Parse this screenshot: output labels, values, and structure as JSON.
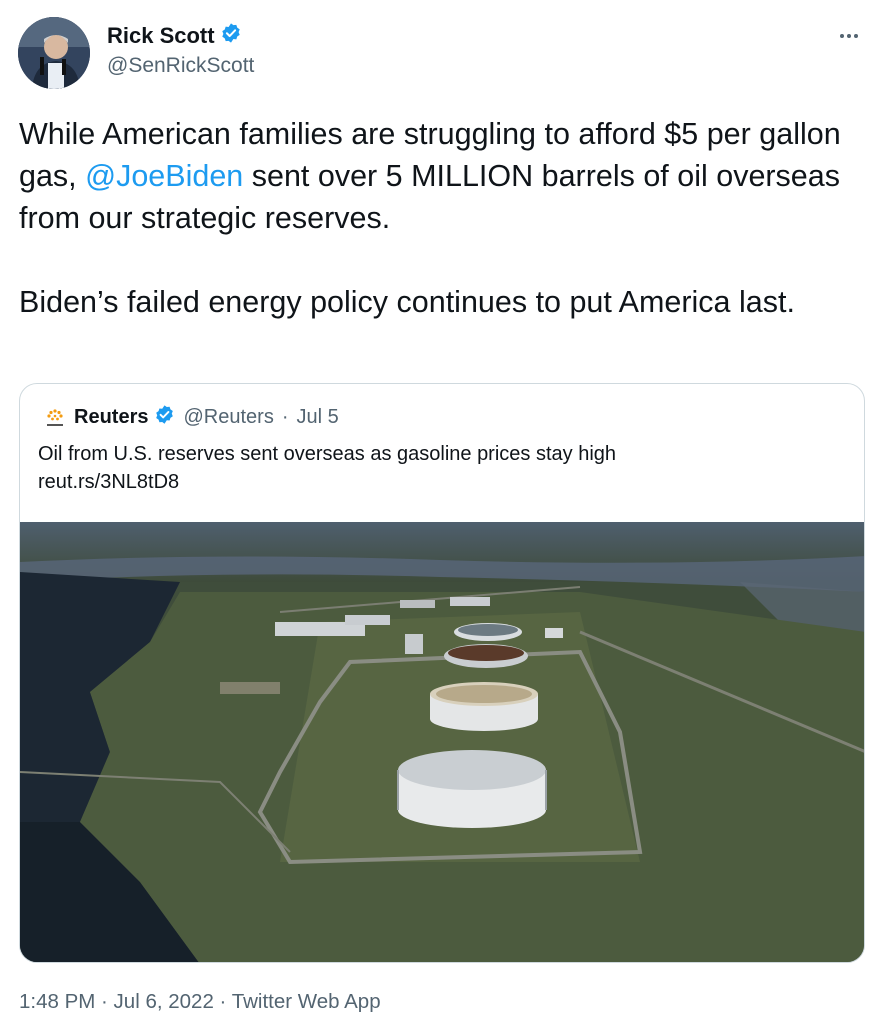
{
  "author": {
    "name": "Rick Scott",
    "handle": "@SenRickScott",
    "verified": true,
    "avatar_icon": "person-at-podium-avatar"
  },
  "more_icon": "ellipsis-icon",
  "tweet": {
    "part1": "While American families are struggling to afford $5 per gallon gas, ",
    "mention": "@JoeBiden",
    "part2": " sent over 5 MILLION barrels of oil overseas from our strategic reserves.\n\nBiden’s failed energy policy continues to put America last."
  },
  "quoted": {
    "name": "Reuters",
    "handle": "@Reuters",
    "separator": "·",
    "date": "Jul 5",
    "verified": true,
    "text": "Oil from U.S. reserves sent overseas as gasoline prices stay high",
    "link": "reut.rs/3NL8tD8",
    "media_icon": "aerial-oil-storage-tanks-photo"
  },
  "footer": {
    "meta": "1:48 PM · Jul 6, 2022 · Twitter Web App"
  },
  "colors": {
    "link_blue": "#1d9bf0",
    "text": "#0f1419",
    "secondary": "#536471",
    "border": "#cfd9de"
  }
}
